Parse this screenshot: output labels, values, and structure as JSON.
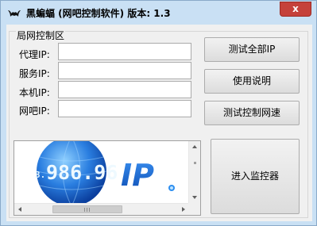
{
  "window": {
    "title": "黑蝙蝠 (网吧控制软件) 版本: 1.3",
    "close_label": "x"
  },
  "group": {
    "title": "局网控制区"
  },
  "fields": [
    {
      "label": "代理IP:",
      "value": ""
    },
    {
      "label": "服务IP:",
      "value": ""
    },
    {
      "label": "本机IP:",
      "value": ""
    },
    {
      "label": "网吧IP:",
      "value": ""
    }
  ],
  "buttons": {
    "test_all": "测试全部IP",
    "help": "使用说明",
    "test_speed": "测试控制网速",
    "enter_monitor": "进入监控器"
  },
  "ad": {
    "ip_number": "986.96",
    "ip_word": "IP"
  },
  "colors": {
    "titlebar": "#c9e0f4",
    "close": "#c5413a",
    "globe": "#1f6fd6",
    "ip_text": "#1a5fc9"
  }
}
